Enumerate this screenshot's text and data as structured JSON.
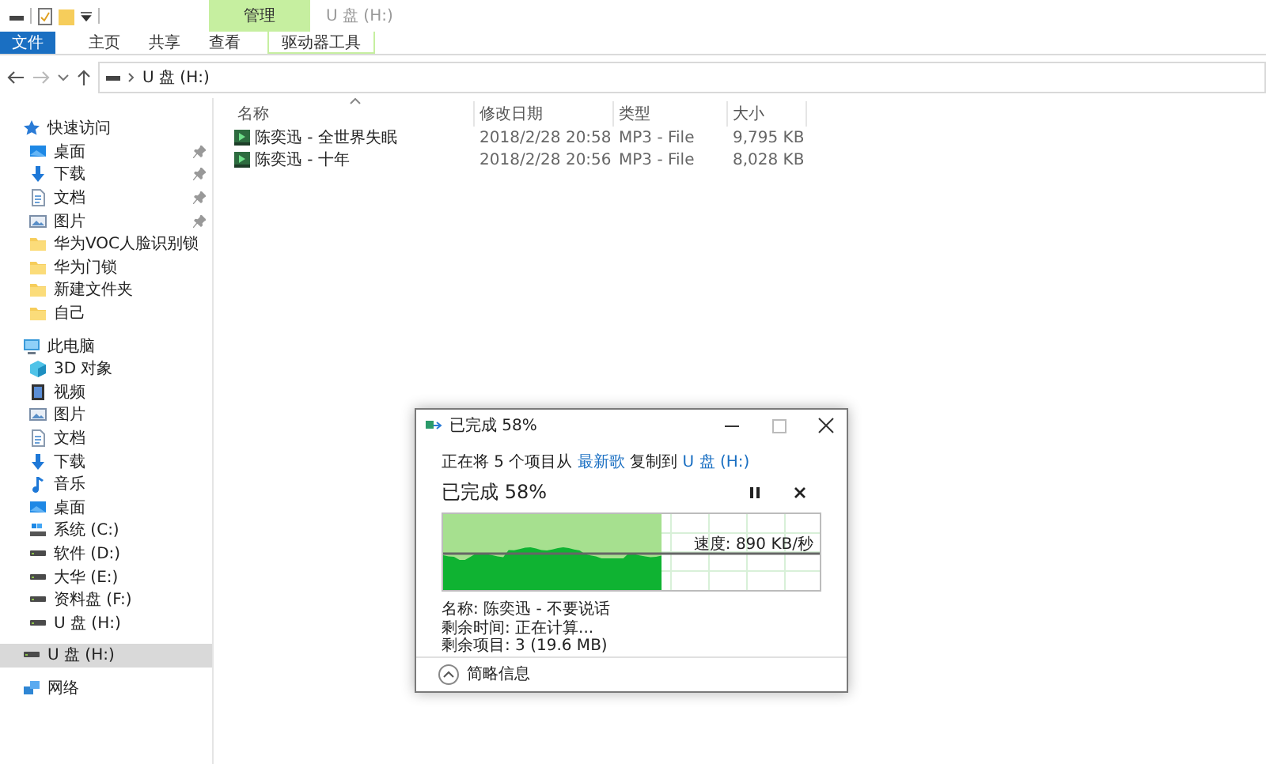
{
  "window": {
    "title": "U 盘 (H:)"
  },
  "ribbon": {
    "context_group": "管理",
    "tabs": [
      {
        "label": "文件",
        "kind": "file"
      },
      {
        "label": "主页",
        "kind": "normal"
      },
      {
        "label": "共享",
        "kind": "normal"
      },
      {
        "label": "查看",
        "kind": "normal"
      },
      {
        "label": "驱动器工具",
        "kind": "context"
      }
    ]
  },
  "address_bar": {
    "path": "U 盘 (H:)"
  },
  "navigation": [
    {
      "label": "快速访问",
      "kind": "star",
      "selected": false,
      "children": [
        {
          "label": "桌面",
          "kind": "desktop",
          "pinned": true,
          "selected": false
        },
        {
          "label": "下载",
          "kind": "download",
          "pinned": true,
          "selected": false
        },
        {
          "label": "文档",
          "kind": "document",
          "pinned": true,
          "selected": false
        },
        {
          "label": "图片",
          "kind": "pictures",
          "pinned": true,
          "selected": false
        },
        {
          "label": "华为VOC人脸识别锁",
          "kind": "folder",
          "pinned": false,
          "selected": false
        },
        {
          "label": "华为门锁",
          "kind": "folder",
          "pinned": false,
          "selected": false
        },
        {
          "label": "新建文件夹",
          "kind": "folder",
          "pinned": false,
          "selected": false
        },
        {
          "label": "自己",
          "kind": "folder",
          "pinned": false,
          "selected": false
        }
      ]
    },
    {
      "label": "此电脑",
      "kind": "pc",
      "selected": false,
      "children": [
        {
          "label": "3D 对象",
          "kind": "cube",
          "pinned": false,
          "selected": false
        },
        {
          "label": "视频",
          "kind": "video",
          "pinned": false,
          "selected": false
        },
        {
          "label": "图片",
          "kind": "pictures",
          "pinned": false,
          "selected": false
        },
        {
          "label": "文档",
          "kind": "document",
          "pinned": false,
          "selected": false
        },
        {
          "label": "下载",
          "kind": "download",
          "pinned": false,
          "selected": false
        },
        {
          "label": "音乐",
          "kind": "music",
          "pinned": false,
          "selected": false
        },
        {
          "label": "桌面",
          "kind": "desktop",
          "pinned": false,
          "selected": false
        },
        {
          "label": "系统 (C:)",
          "kind": "system-drive",
          "pinned": false,
          "selected": false
        },
        {
          "label": "软件 (D:)",
          "kind": "drive",
          "pinned": false,
          "selected": false
        },
        {
          "label": "大华 (E:)",
          "kind": "drive",
          "pinned": false,
          "selected": false
        },
        {
          "label": "资料盘 (F:)",
          "kind": "drive",
          "pinned": false,
          "selected": false
        },
        {
          "label": "U 盘 (H:)",
          "kind": "drive",
          "pinned": false,
          "selected": false
        }
      ]
    },
    {
      "label": "U 盘 (H:)",
      "kind": "drive",
      "selected": true
    },
    {
      "label": "网络",
      "kind": "network",
      "selected": false
    }
  ],
  "file_list": {
    "columns": [
      "名称",
      "修改日期",
      "类型",
      "大小"
    ],
    "rows": [
      {
        "name": "陈奕迅 - 全世界失眠",
        "modified": "2018/2/28 20:58",
        "type": "MP3 - File",
        "size": "9,795 KB"
      },
      {
        "name": "陈奕迅 - 十年",
        "modified": "2018/2/28 20:56",
        "type": "MP3 - File",
        "size": "8,028 KB"
      }
    ]
  },
  "copy_dialog": {
    "title": "已完成 58%",
    "summary": {
      "prefix": "正在将 5 个项目从",
      "source": "最新歌",
      "middle": "复制到",
      "destination": "U 盘 (H:)"
    },
    "heading": "已完成 58%",
    "level": 0.58,
    "speed": "速度: 890 KB/秒",
    "details": [
      "名称: 陈奕迅 - 不要说话",
      "剩余时间: 正在计算...",
      "剩余项目: 3 (19.6 MB)"
    ],
    "toggle": "简略信息"
  }
}
